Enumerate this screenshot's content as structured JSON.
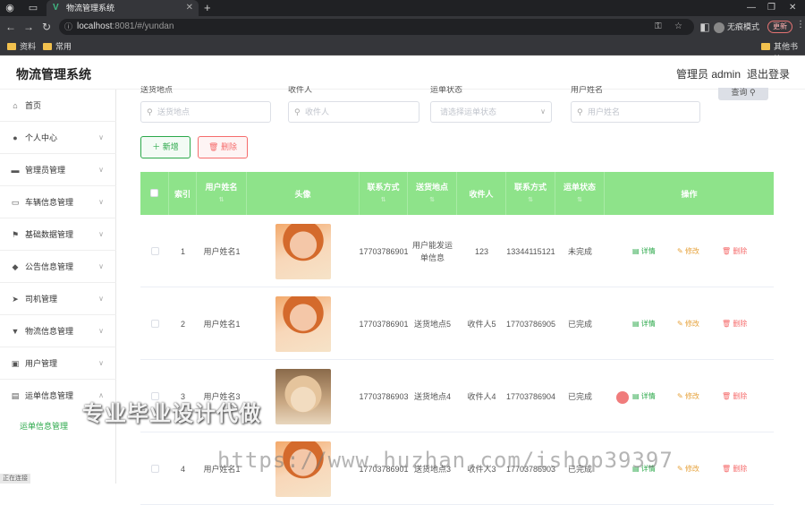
{
  "browser": {
    "tab_title": "物流管理系统",
    "url_host": "localhost",
    "url_rest": ":8081/#/yundan",
    "profile_label": "无痕模式",
    "update_label": "更新",
    "bookmarks": [
      "资料",
      "常用"
    ],
    "other_bookmarks": "其他书签"
  },
  "header": {
    "title": "物流管理系统",
    "admin": "管理员 admin",
    "logout": "退出登录"
  },
  "sidebar": {
    "items": [
      {
        "label": "首页",
        "icon": "home-icon"
      },
      {
        "label": "个人中心",
        "icon": "user-icon"
      },
      {
        "label": "管理员管理",
        "icon": "briefcase-icon"
      },
      {
        "label": "车辆信息管理",
        "icon": "chat-icon"
      },
      {
        "label": "基础数据管理",
        "icon": "flag-icon"
      },
      {
        "label": "公告信息管理",
        "icon": "location-icon"
      },
      {
        "label": "司机管理",
        "icon": "send-icon"
      },
      {
        "label": "物流信息管理",
        "icon": "pin-icon"
      },
      {
        "label": "用户管理",
        "icon": "image-icon"
      },
      {
        "label": "运单信息管理",
        "icon": "ticket-icon"
      }
    ],
    "sub_active": "运单信息管理"
  },
  "filters": {
    "labels": [
      "送货地点",
      "收件人",
      "运单状态",
      "用户姓名"
    ],
    "placeholders": [
      "送货地点",
      "收件人",
      "请选择运单状态",
      "用户姓名"
    ],
    "query": "查询"
  },
  "actions": {
    "add": "新增",
    "delete": "删除"
  },
  "table": {
    "columns": [
      "索引",
      "用户姓名",
      "头像",
      "联系方式",
      "送货地点",
      "收件人",
      "联系方式",
      "运单状态",
      "操作"
    ],
    "op_labels": {
      "detail": "详情",
      "edit": "修改",
      "delete": "删除"
    },
    "rows": [
      {
        "index": "1",
        "name": "用户姓名1",
        "avatar": "girl",
        "phone": "17703786901",
        "place": "用户能发运单信息",
        "recipient": "123",
        "rphone": "13344115121",
        "status": "未完成"
      },
      {
        "index": "2",
        "name": "用户姓名1",
        "avatar": "girl",
        "phone": "17703786901",
        "place": "送货地点5",
        "recipient": "收件人5",
        "rphone": "17703786905",
        "status": "已完成"
      },
      {
        "index": "3",
        "name": "用户姓名3",
        "avatar": "dog",
        "phone": "17703786903",
        "place": "送货地点4",
        "recipient": "收件人4",
        "rphone": "17703786904",
        "status": "已完成"
      },
      {
        "index": "4",
        "name": "用户姓名1",
        "avatar": "girl",
        "phone": "17703786901",
        "place": "送货地点3",
        "recipient": "收件人3",
        "rphone": "17703786903",
        "status": "已完成"
      }
    ]
  },
  "overlay": {
    "watermark_cn": "专业毕业设计代做",
    "watermark_url": "https://www.huzhan.com/ishop39397",
    "status_text": "正在连接"
  }
}
